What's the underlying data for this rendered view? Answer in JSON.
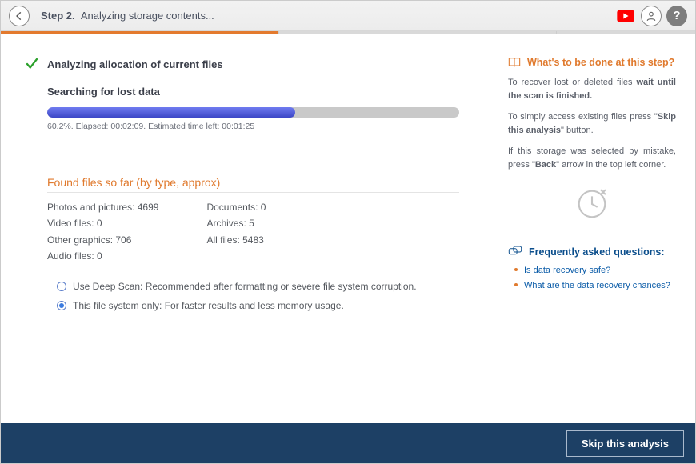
{
  "header": {
    "step_label": "Step 2.",
    "step_desc": "Analyzing storage contents..."
  },
  "left": {
    "done_label": "Analyzing allocation of current files",
    "active_label": "Searching for lost data",
    "progress_text": "60.2%. Elapsed: 00:02:09. Estimated time left: 00:01:25",
    "found_title": "Found files so far (by type, approx)",
    "stats_col1": {
      "photos": "Photos and pictures: 4699",
      "video": "Video files: 0",
      "other": "Other graphics: 706",
      "audio": "Audio files: 0"
    },
    "stats_col2": {
      "docs": "Documents: 0",
      "arch": "Archives: 5",
      "all": "All files: 5483"
    },
    "opt_deep": "Use Deep Scan: Recommended after formatting or severe file system corruption.",
    "opt_fs": "This file system only: For faster results and less memory usage."
  },
  "right": {
    "title": "What's to be done at this step?",
    "p1a": "To recover lost or deleted files ",
    "p1b": "wait until the scan is finished.",
    "p2a": "To simply access existing files press \"",
    "p2b": "Skip this analysis",
    "p2c": "\" button.",
    "p3a": "If this storage was selected by mistake, press \"",
    "p3b": "Back",
    "p3c": "\" arrow in the top left corner.",
    "faq_title": "Frequently asked questions:",
    "faq1": "Is data recovery safe?",
    "faq2": "What are the data recovery chances?"
  },
  "footer": {
    "skip_label": "Skip this analysis"
  }
}
